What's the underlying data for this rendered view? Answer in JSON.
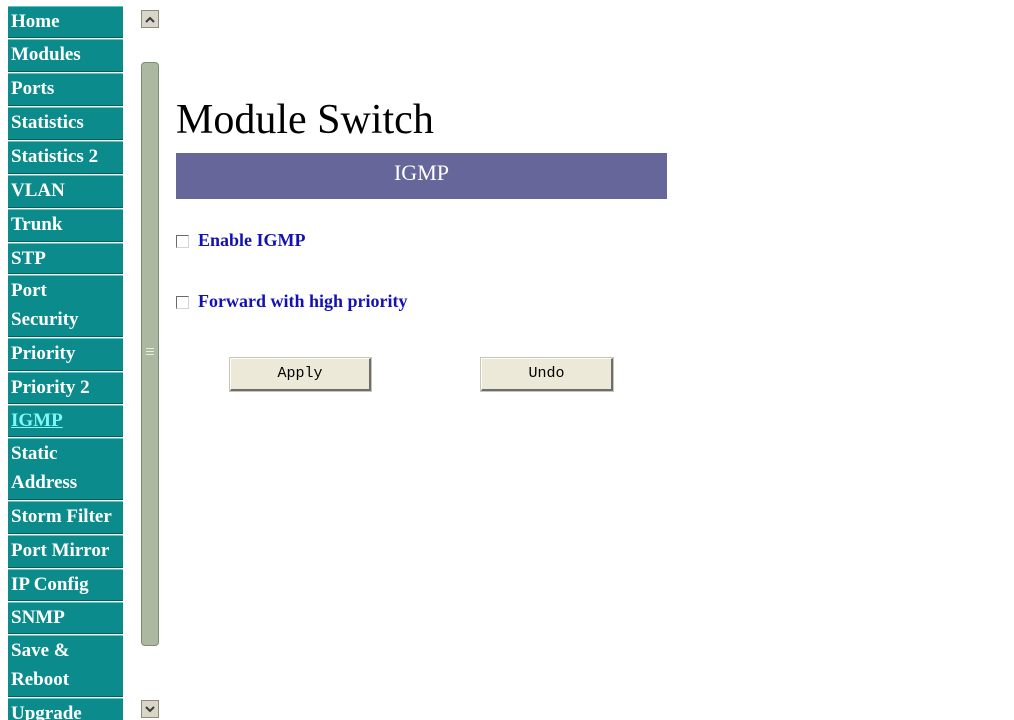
{
  "nav": {
    "items": [
      {
        "label": "Home"
      },
      {
        "label": "Modules"
      },
      {
        "label": "Ports"
      },
      {
        "label": "Statistics"
      },
      {
        "label": "Statistics 2"
      },
      {
        "label": "VLAN"
      },
      {
        "label": "Trunk"
      },
      {
        "label": "STP"
      },
      {
        "label": "Port Security"
      },
      {
        "label": "Priority"
      },
      {
        "label": "Priority 2"
      },
      {
        "label": "IGMP",
        "active": true
      },
      {
        "label": "Static Address"
      },
      {
        "label": "Storm Filter"
      },
      {
        "label": "Port Mirror"
      },
      {
        "label": "IP Config"
      },
      {
        "label": "SNMP"
      },
      {
        "label": "Save & Reboot"
      },
      {
        "label": "Upgrade"
      }
    ],
    "colors": {
      "background": "#0b8b8b",
      "text": "#ffffff",
      "active_text": "#7ff7f7"
    }
  },
  "scrollbar": {
    "up_icon": "arrow-up-icon",
    "down_icon": "arrow-down-icon"
  },
  "main": {
    "title": "Module Switch",
    "section_title": "IGMP",
    "section_color": "#66669a",
    "options": [
      {
        "label": "Enable IGMP",
        "checked": false
      },
      {
        "label": "Forward with high priority",
        "checked": false
      }
    ],
    "buttons": {
      "apply": "Apply",
      "undo": "Undo"
    },
    "option_color": "#1212b4"
  }
}
